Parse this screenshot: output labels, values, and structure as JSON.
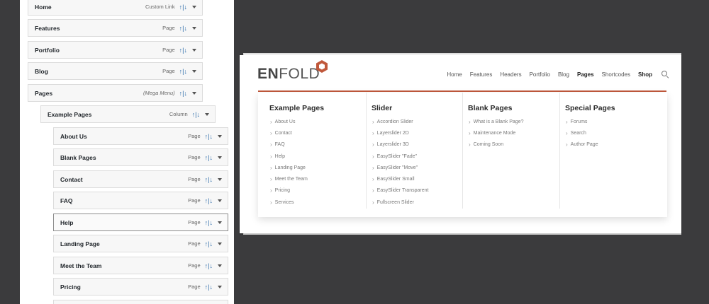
{
  "menu_editor": {
    "items": [
      {
        "title": "Home",
        "type": "Custom Link",
        "arrows": "↑|↓",
        "selected": false
      },
      {
        "title": "Features",
        "type": "Page",
        "arrows": "↑|↓",
        "selected": false
      },
      {
        "title": "Portfolio",
        "type": "Page",
        "arrows": "↑|↓",
        "selected": false
      },
      {
        "title": "Blog",
        "type": "Page",
        "arrows": "↑|↓",
        "selected": false
      },
      {
        "title": "Pages",
        "type": "(Mega Menu)",
        "arrows": "↑|↓",
        "selected": false
      },
      {
        "title": "Example Pages",
        "type": "Column",
        "arrows": "↑|↓",
        "selected": false
      },
      {
        "title": "About Us",
        "type": "Page",
        "arrows": "↑|↓",
        "selected": false
      },
      {
        "title": "Blank Pages",
        "type": "Page",
        "arrows": "↑|↓",
        "selected": false
      },
      {
        "title": "Contact",
        "type": "Page",
        "arrows": "↑|↓",
        "selected": false
      },
      {
        "title": "FAQ",
        "type": "Page",
        "arrows": "↑|↓",
        "selected": false
      },
      {
        "title": "Help",
        "type": "Page",
        "arrows": "↑|↓",
        "selected": true
      },
      {
        "title": "Landing Page",
        "type": "Page",
        "arrows": "↑|↓",
        "selected": false
      },
      {
        "title": "Meet the Team",
        "type": "Page",
        "arrows": "↑|↓",
        "selected": false
      },
      {
        "title": "Pricing",
        "type": "Page",
        "arrows": "↑|↓",
        "selected": false
      }
    ]
  },
  "site": {
    "logo_en": "EN",
    "logo_fold": "FOLD",
    "accent_color": "#c0583b",
    "nav": [
      "Home",
      "Features",
      "Headers",
      "Portfolio",
      "Blog",
      "Pages",
      "Shortcodes",
      "Shop"
    ],
    "active_nav": "Pages",
    "mega_menu": [
      {
        "title": "Example Pages",
        "links": [
          "About Us",
          "Contact",
          "FAQ",
          "Help",
          "Landing Page",
          "Meet the Team",
          "Pricing",
          "Services"
        ]
      },
      {
        "title": "Slider",
        "links": [
          "Accordion Slider",
          "Layerslider 2D",
          "Layerslider 3D",
          "EasySlider \"Fade\"",
          "EasySlider \"Move\"",
          "EasySlider Small",
          "EasySlider Transparent",
          "Fullscreen Slider"
        ]
      },
      {
        "title": "Blank Pages",
        "links": [
          "What is a Blank Page?",
          "Maintenance Mode",
          "Coming Soon"
        ]
      },
      {
        "title": "Special Pages",
        "links": [
          "Forums",
          "Search",
          "Author Page"
        ]
      }
    ]
  }
}
